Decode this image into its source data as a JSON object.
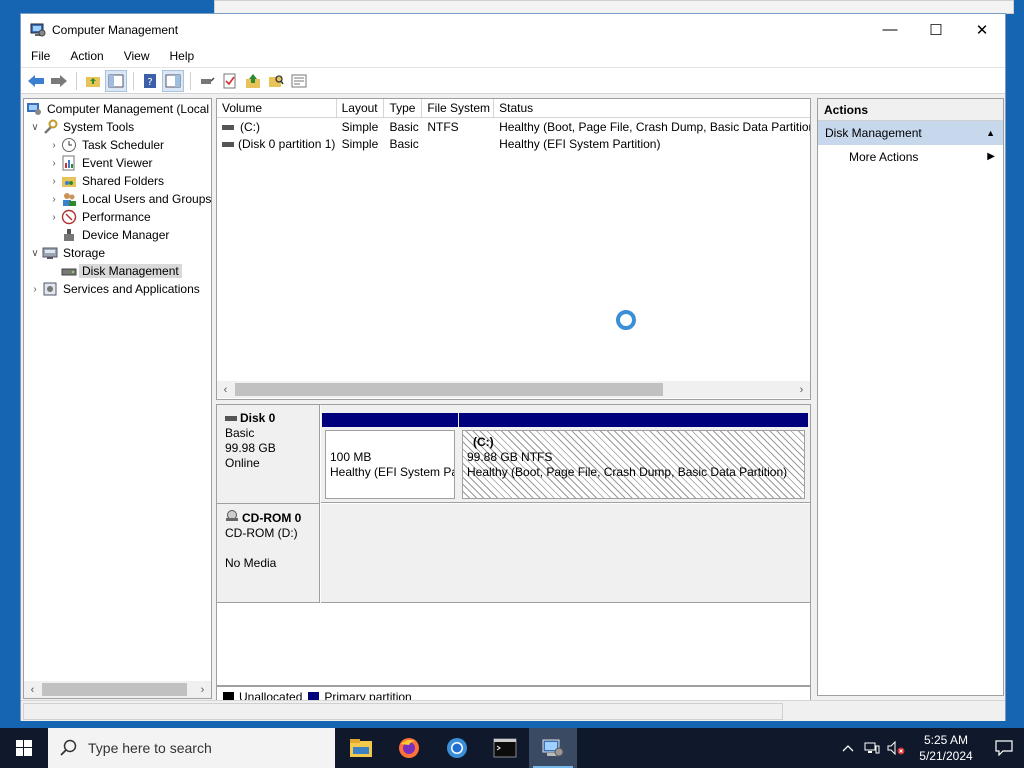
{
  "window": {
    "title": "Computer Management",
    "controls": {
      "minimize": "—",
      "maximize": "☐",
      "close": "✕"
    }
  },
  "menu": [
    "File",
    "Action",
    "View",
    "Help"
  ],
  "tree": {
    "root": "Computer Management (Local",
    "system_tools": "System Tools",
    "task_scheduler": "Task Scheduler",
    "event_viewer": "Event Viewer",
    "shared_folders": "Shared Folders",
    "local_users": "Local Users and Groups",
    "performance": "Performance",
    "device_manager": "Device Manager",
    "storage": "Storage",
    "disk_management": "Disk Management",
    "services": "Services and Applications"
  },
  "volumes": {
    "columns": [
      "Volume",
      "Layout",
      "Type",
      "File System",
      "Status"
    ],
    "rows": [
      {
        "volume": "(C:)",
        "layout": "Simple",
        "type": "Basic",
        "fs": "NTFS",
        "status": "Healthy (Boot, Page File, Crash Dump, Basic Data Partition)"
      },
      {
        "volume": "(Disk 0 partition 1)",
        "layout": "Simple",
        "type": "Basic",
        "fs": "",
        "status": "Healthy (EFI System Partition)"
      }
    ]
  },
  "disks": {
    "disk0": {
      "name": "Disk 0",
      "type": "Basic",
      "size": "99.98 GB",
      "state": "Online",
      "partitions": [
        {
          "title": "",
          "size": "100 MB",
          "status": "Healthy (EFI System Par"
        },
        {
          "title": "(C:)",
          "size": "99.88 GB NTFS",
          "status": "Healthy (Boot, Page File, Crash Dump, Basic Data Partition)"
        }
      ]
    },
    "cdrom0": {
      "name": "CD-ROM 0",
      "drive": "CD-ROM (D:)",
      "media": "No Media"
    }
  },
  "legend": {
    "unallocated": "Unallocated",
    "primary": "Primary partition",
    "colors": {
      "unallocated": "#000000",
      "primary": "#00007d"
    }
  },
  "actions": {
    "header": "Actions",
    "section": "Disk Management",
    "more": "More Actions"
  },
  "taskbar": {
    "search_placeholder": "Type here to search",
    "time": "5:25 AM",
    "date": "5/21/2024",
    "apps": [
      "file-explorer-icon",
      "firefox-icon",
      "chrome-icon",
      "terminal-icon",
      "computer-management-icon"
    ]
  }
}
